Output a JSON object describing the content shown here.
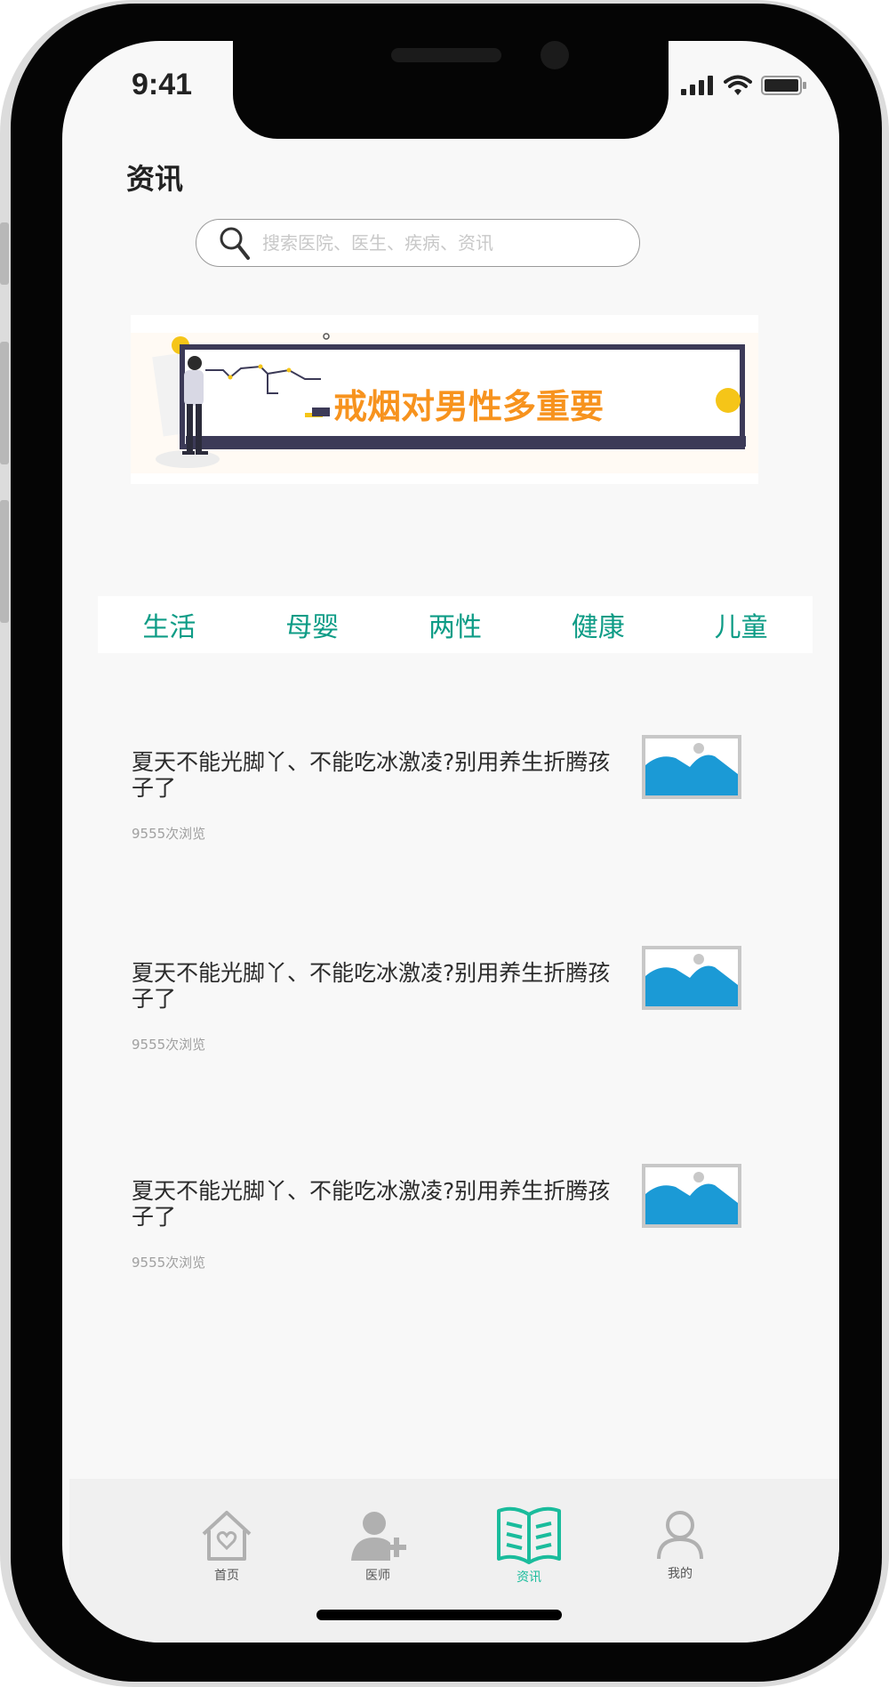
{
  "status_bar": {
    "time": "9:41"
  },
  "header": {
    "title": "资讯"
  },
  "search": {
    "placeholder": "搜索医院、医生、疾病、资讯",
    "value": ""
  },
  "banner": {
    "text": "戒烟对男性多重要"
  },
  "categories": [
    "生活",
    "母婴",
    "两性",
    "健康",
    "儿童"
  ],
  "articles": [
    {
      "title": "夏天不能光脚丫、不能吃冰激凌?别用养生折腾孩子了",
      "views": "9555次浏览",
      "thumbnail_icon": "image-placeholder-icon"
    },
    {
      "title": "夏天不能光脚丫、不能吃冰激凌?别用养生折腾孩子了",
      "views": "9555次浏览",
      "thumbnail_icon": "image-placeholder-icon"
    },
    {
      "title": "夏天不能光脚丫、不能吃冰激凌?别用养生折腾孩子了",
      "views": "9555次浏览",
      "thumbnail_icon": "image-placeholder-icon"
    }
  ],
  "tabbar": {
    "items": [
      {
        "label": "首页",
        "icon": "home-heart-icon",
        "active": false
      },
      {
        "label": "医师",
        "icon": "doctor-add-icon",
        "active": false
      },
      {
        "label": "资讯",
        "icon": "book-icon",
        "active": true
      },
      {
        "label": "我的",
        "icon": "user-icon",
        "active": false
      }
    ]
  },
  "colors": {
    "accent": "#0e9c86",
    "active_tab": "#1abc9c",
    "banner_text": "#f7931e",
    "thumbnail_blue": "#1b9ad6"
  }
}
